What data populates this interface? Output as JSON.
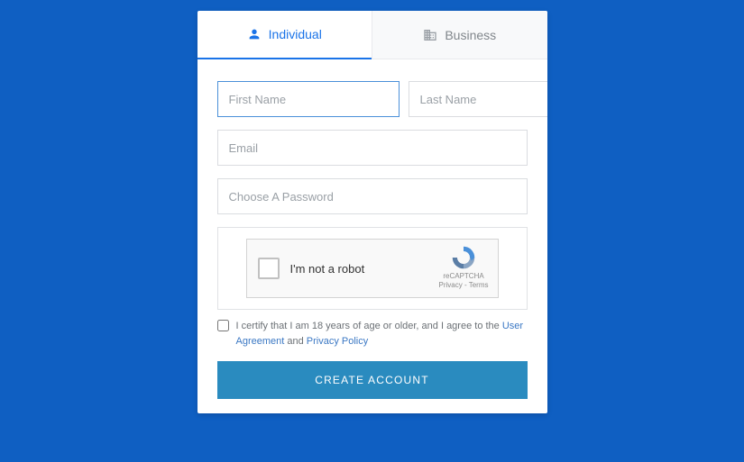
{
  "tabs": {
    "individual": "Individual",
    "business": "Business"
  },
  "fields": {
    "first_name_placeholder": "First Name",
    "last_name_placeholder": "Last Name",
    "email_placeholder": "Email",
    "password_placeholder": "Choose A Password"
  },
  "captcha": {
    "label": "I'm not a robot",
    "brand": "reCAPTCHA",
    "legal": "Privacy - Terms"
  },
  "consent": {
    "prefix": "I certify that I am 18 years of age or older, and I agree to the ",
    "link1": "User Agreement",
    "mid": " and ",
    "link2": "Privacy Policy"
  },
  "submit_label": "CREATE ACCOUNT"
}
